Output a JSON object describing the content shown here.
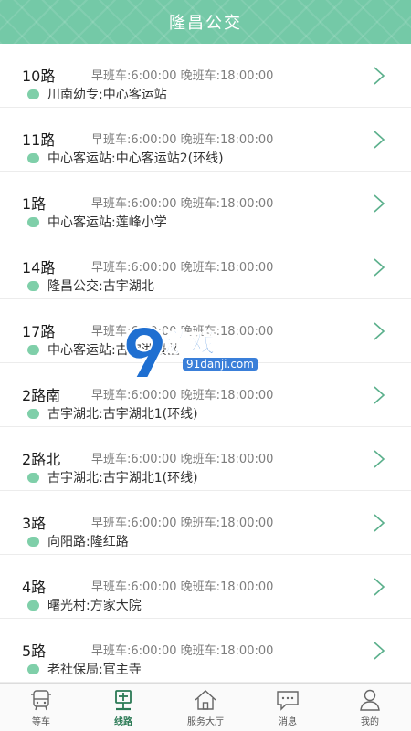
{
  "header": {
    "title": "隆昌公交"
  },
  "routes": [
    {
      "name": "10路",
      "schedule": "早班车:6:00:00 晚班车:18:00:00",
      "stops": "川南幼专:中心客运站"
    },
    {
      "name": "11路",
      "schedule": "早班车:6:00:00 晚班车:18:00:00",
      "stops": "中心客运站:中心客运站2(环线)"
    },
    {
      "name": "1路",
      "schedule": "早班车:6:00:00 晚班车:18:00:00",
      "stops": "中心客运站:莲峰小学"
    },
    {
      "name": "14路",
      "schedule": "早班车:6:00:00 晚班车:18:00:00",
      "stops": "隆昌公交:古宇湖北"
    },
    {
      "name": "17路",
      "schedule": "早班车:6:00:00 晚班车:18:00:00",
      "stops": "中心客运站:古宇湖景区"
    },
    {
      "name": "2路南",
      "schedule": "早班车:6:00:00 晚班车:18:00:00",
      "stops": "古宇湖北:古宇湖北1(环线)"
    },
    {
      "name": "2路北",
      "schedule": "早班车:6:00:00 晚班车:18:00:00",
      "stops": "古宇湖北:古宇湖北1(环线)"
    },
    {
      "name": "3路",
      "schedule": "早班车:6:00:00 晚班车:18:00:00",
      "stops": "向阳路:隆红路"
    },
    {
      "name": "4路",
      "schedule": "早班车:6:00:00 晚班车:18:00:00",
      "stops": "曙光村:方家大院"
    },
    {
      "name": "5路",
      "schedule": "早班车:6:00:00 晚班车:18:00:00",
      "stops": "老社保局:官主寺"
    }
  ],
  "tabs": [
    {
      "label": "等车",
      "icon": "bus-icon"
    },
    {
      "label": "线路",
      "icon": "route-sign-icon"
    },
    {
      "label": "服务大厅",
      "icon": "home-icon"
    },
    {
      "label": "消息",
      "icon": "message-icon"
    },
    {
      "label": "我的",
      "icon": "user-icon"
    }
  ],
  "watermark": {
    "text": "游戏",
    "url": "91danji.com"
  },
  "colors": {
    "accent": "#74c9a7",
    "dot": "#7fcfa9",
    "chevron": "#5bb08c",
    "active_tab": "#2b7a55"
  }
}
